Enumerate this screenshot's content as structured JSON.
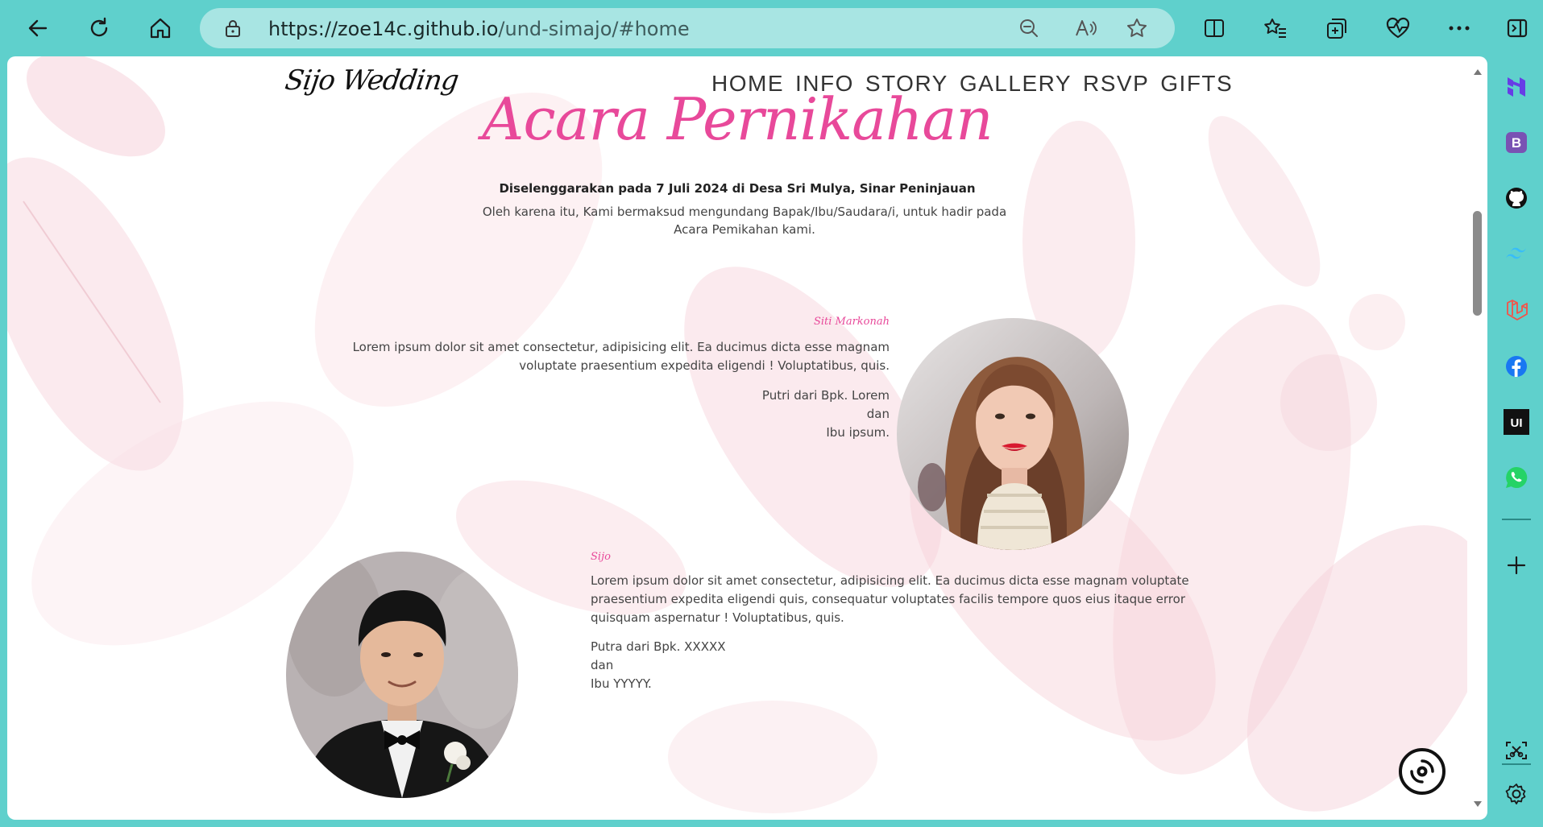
{
  "browser": {
    "url_host": "https://zoe14c.github.io",
    "url_path": "/und-simajo/#home",
    "accent": "#5fd0cc",
    "toolbar_icons": [
      "back-icon",
      "refresh-icon",
      "home-icon",
      "lock-icon",
      "zoom-out-icon",
      "read-aloud-icon",
      "favorite-star-icon",
      "split-screen-icon",
      "favorites-icon",
      "collections-icon",
      "performance-icon",
      "more-icon",
      "sidebar-toggle-icon"
    ],
    "sidebar_icons": [
      "hostinger-icon",
      "bootstrap-icon",
      "github-icon",
      "tailwind-icon",
      "laravel-icon",
      "facebook-icon",
      "ui-icon",
      "whatsapp-icon",
      "add-icon",
      "screenshot-icon",
      "settings-icon"
    ],
    "ui_badge": "UI",
    "bootstrap_badge": "B"
  },
  "site": {
    "brand": "Sijo Wedding",
    "nav": [
      "HOME",
      "INFO",
      "STORY",
      "GALLERY",
      "RSVP",
      "GIFTS"
    ],
    "heading": "Acara Pernikahan",
    "heading_color": "#e8499a",
    "event_strong": "Diselenggarakan pada 7 Juli 2024 di Desa Sri Mulya, Sinar Peninjauan",
    "event_sub": "Oleh karena itu, Kami bermaksud mengundang Bapak/Ibu/Saudara/i, untuk hadir pada Acara Pemikahan kami.",
    "bride": {
      "name": "Siti Markonah",
      "desc": "Lorem ipsum dolor sit amet consectetur, adipisicing elit. Ea ducimus dicta esse magnam voluptate praesentium expedita eligendi ! Voluptatibus, quis.",
      "parent_line1": "Putri dari Bpk. Lorem",
      "parent_line2": "dan",
      "parent_line3": "Ibu ipsum."
    },
    "groom": {
      "name": "Sijo",
      "desc": "Lorem ipsum dolor sit amet consectetur, adipisicing elit. Ea ducimus dicta esse magnam voluptate praesentium expedita eligendi quis, consequatur voluptates facilis tempore quos eius itaque error quisquam aspernatur ! Voluptatibus, quis.",
      "parent_line1": "Putra dari Bpk. XXXXX",
      "parent_line2": "dan",
      "parent_line3": "Ibu YYYYY."
    }
  }
}
